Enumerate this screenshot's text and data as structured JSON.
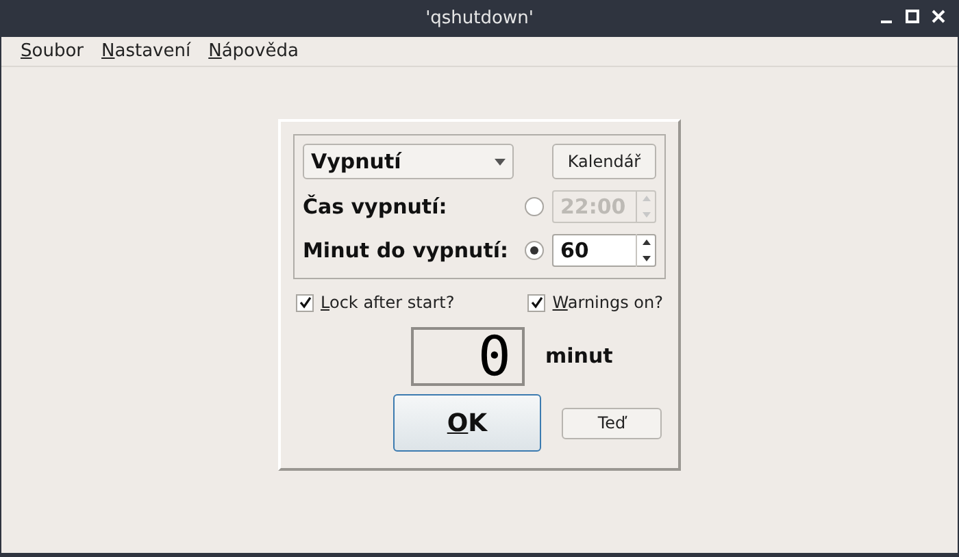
{
  "window": {
    "title": "'qshutdown'"
  },
  "menu": [
    "Soubor",
    "Nastavení",
    "Nápověda"
  ],
  "action": {
    "value": "Vypnutí"
  },
  "calendar_button": "Kalendář",
  "modes": [
    {
      "label": "Čas vypnutí:",
      "selected": false,
      "value": "22:00"
    },
    {
      "label": "Minut do vypnutí:",
      "selected": true,
      "value": "60"
    }
  ],
  "options": [
    {
      "label": "Lock after start?",
      "checked": true
    },
    {
      "label": "Warnings on?",
      "checked": true
    }
  ],
  "display": {
    "value": "0",
    "unit": "minut"
  },
  "ok_button": "OK",
  "now_button": "Teď"
}
